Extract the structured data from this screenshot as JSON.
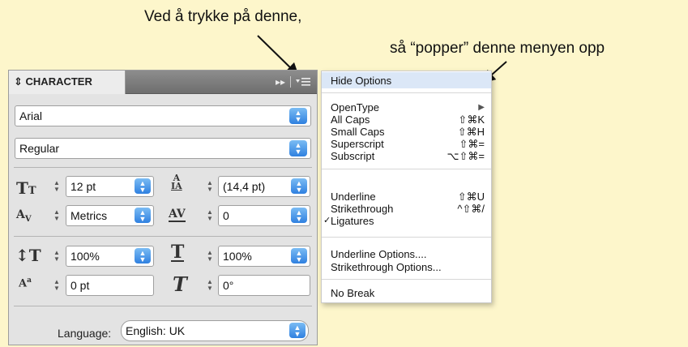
{
  "annotations": {
    "line1": "Ved å trykke på denne,",
    "line2": "så “popper” denne menyen opp"
  },
  "panel": {
    "tab_icon": "⇕",
    "tab_label": "CHARACTER",
    "collapse_glyph": "▸▸",
    "font_family": "Arial",
    "font_style": "Regular",
    "font_size": "12 pt",
    "leading": "(14,4 pt)",
    "kerning": "Metrics",
    "tracking": "0",
    "vertical_scale": "100%",
    "horizontal_scale": "100%",
    "baseline_shift": "0 pt",
    "skew": "0°",
    "language_label": "Language:",
    "language_value": "English: UK",
    "icons": {
      "font_size": "font-size-icon",
      "leading": "leading-icon",
      "kerning": "kerning-icon",
      "tracking": "tracking-icon",
      "vertical_scale": "vertical-scale-icon",
      "horizontal_scale": "horizontal-scale-icon",
      "baseline_shift": "baseline-shift-icon",
      "skew": "skew-icon"
    }
  },
  "menu": {
    "hide_options": "Hide Options",
    "opentype": "OpenType",
    "opentype_arrow": "▶",
    "all_caps": "All Caps",
    "all_caps_sc": "⇧⌘K",
    "small_caps": "Small Caps",
    "small_caps_sc": "⇧⌘H",
    "superscript": "Superscript",
    "superscript_sc": "⇧⌘=",
    "subscript": "Subscript",
    "subscript_sc": "⌥⇧⌘=",
    "underline": "Underline",
    "underline_sc": "⇧⌘U",
    "strikethrough": "Strikethrough",
    "strikethrough_sc": "^⇧⌘/",
    "ligatures": "Ligatures",
    "ligatures_check": "✓",
    "underline_options": "Underline Options....",
    "strikethrough_options": "Strikethrough Options...",
    "no_break": "No Break"
  },
  "colors": {
    "background": "#fdf6cb",
    "select_button": "#2f80e0",
    "menu_highlight": "#dbe7f7"
  }
}
